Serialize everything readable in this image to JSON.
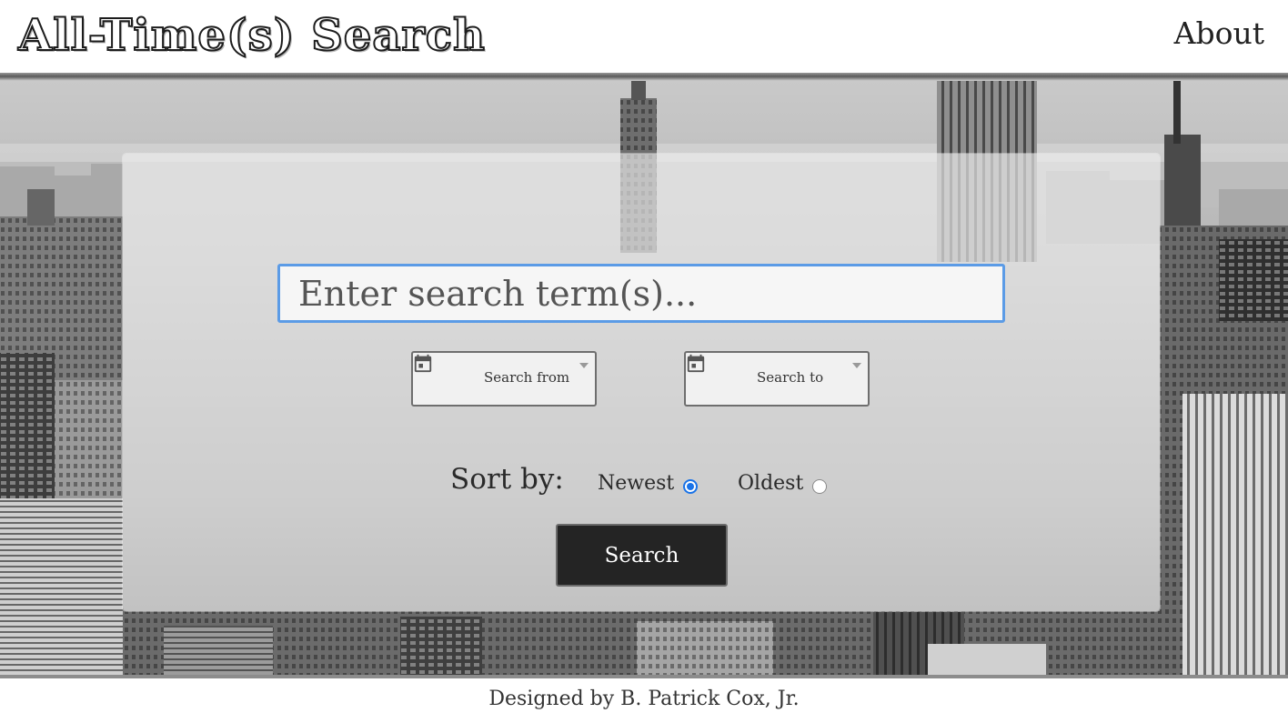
{
  "header": {
    "logo_text": "All-Time(s) Search",
    "about_label": "About"
  },
  "search": {
    "placeholder": "Enter search term(s)..."
  },
  "date_range": {
    "from_label": "Search from",
    "to_label": "Search to"
  },
  "sort": {
    "label": "Sort by:",
    "options": [
      {
        "label": "Newest",
        "checked": true
      },
      {
        "label": "Oldest",
        "checked": false
      }
    ]
  },
  "button": {
    "search_label": "Search"
  },
  "footer": {
    "credit": "Designed by B. Patrick Cox, Jr."
  },
  "colors": {
    "accent": "#1a73e8",
    "input_border": "#5b9be6",
    "button_bg": "#242424"
  },
  "icons": {
    "calendar": "calendar-icon",
    "dropdown": "chevron-down-icon"
  }
}
